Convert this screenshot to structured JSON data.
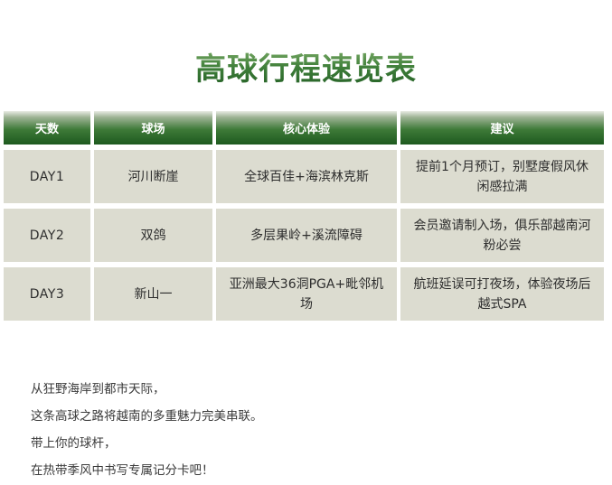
{
  "title": "高球行程速览表",
  "table": {
    "headers": [
      "天数",
      "球场",
      "核心体验",
      "建议"
    ],
    "rows": [
      {
        "day": "DAY1",
        "course": "河川断崖",
        "experience": "全球百佳+海滨林克斯",
        "advice": "提前1个月预订，别墅度假风休闲感拉满"
      },
      {
        "day": "DAY2",
        "course": "双鸽",
        "experience": "多层果岭+溪流障碍",
        "advice": "会员邀请制入场，俱乐部越南河粉必尝"
      },
      {
        "day": "DAY3",
        "course": "新山一",
        "experience": "亚洲最大36洞PGA+毗邻机场",
        "advice": "航班延误可打夜场，体验夜场后越式SPA"
      }
    ]
  },
  "paragraph": [
    "从狂野海岸到都市天际，",
    "这条高球之路将越南的多重魅力完美串联。",
    "带上你的球杆，",
    "在热带季风中书写专属记分卡吧！"
  ],
  "colors": {
    "header_green": "#1e5a1f",
    "title_green": "#3f7f3a",
    "cell_bg": "#dcdcd0"
  }
}
